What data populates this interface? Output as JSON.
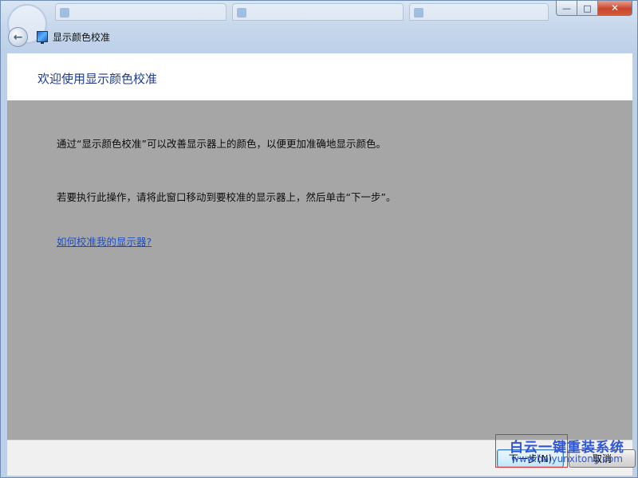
{
  "window": {
    "title": "显示颜色校准",
    "caption": {
      "minimize": "—",
      "maximize": "□",
      "close": "✕"
    },
    "back_icon": "back-arrow-icon",
    "app_icon": "display-color-calibration-icon"
  },
  "header": {
    "heading": "欢迎使用显示颜色校准"
  },
  "main": {
    "paragraph1": "通过“显示颜色校准”可以改善显示器上的颜色，以便更加准确地显示颜色。",
    "paragraph2": "若要执行此操作，请将此窗口移动到要校准的显示器上，然后单击“下一步”。",
    "help_link": "如何校准我的显示器?"
  },
  "buttons": {
    "next": "下一步(N)",
    "cancel": "取消"
  },
  "watermark": {
    "name": "白云一键重装系统",
    "url": "www.baiyunxitong.com"
  },
  "colors": {
    "heading": "#1e3b8c",
    "link": "#1f4fbf",
    "content_background": "#a6a6a6",
    "highlight": "#e23030",
    "watermark": "#2f56d6"
  }
}
